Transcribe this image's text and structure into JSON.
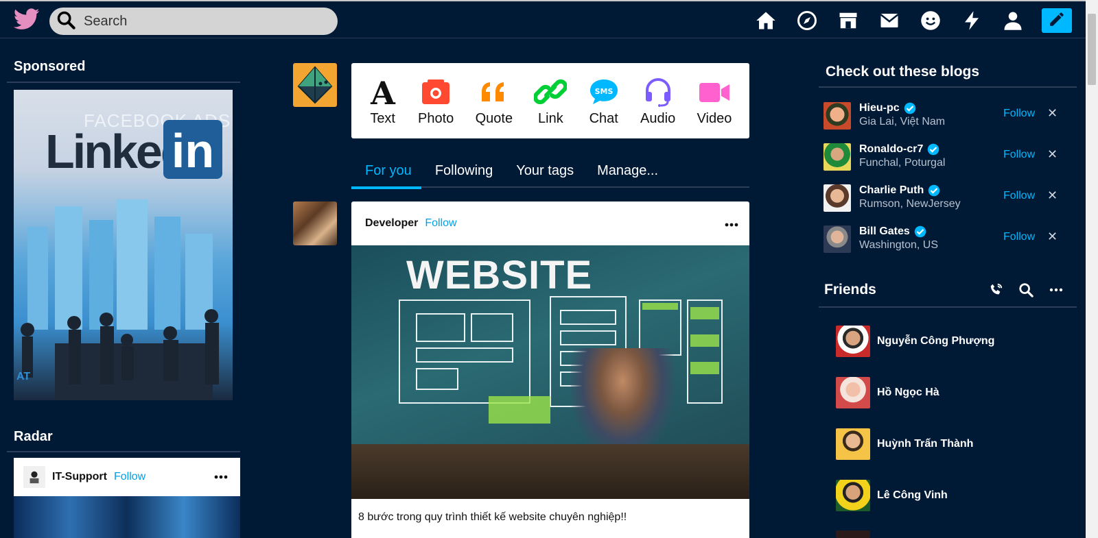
{
  "search": {
    "placeholder": "Search"
  },
  "nav": {
    "icons": [
      "home-icon",
      "explore-icon",
      "store-icon",
      "mail-icon",
      "emoji-icon",
      "activity-icon",
      "account-icon"
    ],
    "compose_icon": "pencil-icon"
  },
  "left": {
    "sponsored_title": "Sponsored",
    "ad": {
      "top_text": "FACEBOOK ADS",
      "brand_text": "Linked",
      "brand_box": "in",
      "corner_text": "AT"
    },
    "radar_title": "Radar",
    "radar_post": {
      "author": "IT-Support",
      "follow": "Follow"
    }
  },
  "post_types": [
    {
      "label": "Text",
      "icon": "text-icon"
    },
    {
      "label": "Photo",
      "icon": "camera-icon"
    },
    {
      "label": "Quote",
      "icon": "quote-icon"
    },
    {
      "label": "Link",
      "icon": "link-icon"
    },
    {
      "label": "Chat",
      "icon": "chat-icon"
    },
    {
      "label": "Audio",
      "icon": "headphones-icon"
    },
    {
      "label": "Video",
      "icon": "video-icon"
    }
  ],
  "tabs": [
    "For you",
    "Following",
    "Your tags",
    "Manage..."
  ],
  "post": {
    "author": "Developer",
    "follow": "Follow",
    "image_title": "WEBSITE",
    "text": "8 bước trong quy trình thiết kế website chuyên nghiệp!!"
  },
  "blogs": {
    "title": "Check out these blogs",
    "items": [
      {
        "name": "Hieu-pc",
        "location": "Gia Lai, Việt Nam",
        "follow": "Follow",
        "close": "✕"
      },
      {
        "name": "Ronaldo-cr7",
        "location": "Funchal, Poturgal",
        "follow": "Follow",
        "close": "✕"
      },
      {
        "name": "Charlie Puth",
        "location": "Rumson, NewJersey",
        "follow": "Follow",
        "close": "✕"
      },
      {
        "name": "Bill Gates",
        "location": "Washington, US",
        "follow": "Follow",
        "close": "✕"
      }
    ]
  },
  "friends": {
    "title": "Friends",
    "icons": [
      "call-icon",
      "search-icon",
      "more-icon"
    ],
    "items": [
      {
        "name": "Nguyễn Công Phượng"
      },
      {
        "name": "Hồ Ngọc Hà"
      },
      {
        "name": "Huỳnh Trấn Thành"
      },
      {
        "name": "Lê Công Vinh"
      }
    ]
  },
  "colors": {
    "background": "#001935",
    "accent": "#00b8ff"
  }
}
